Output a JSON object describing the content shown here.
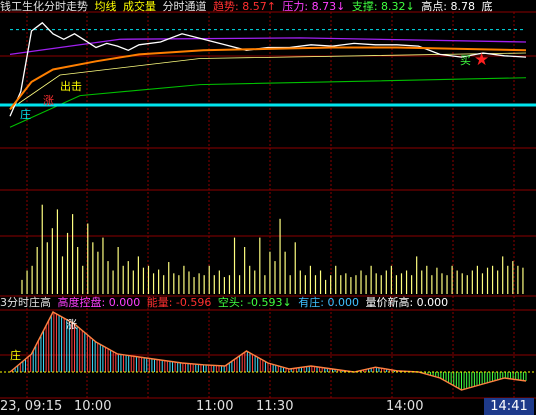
{
  "header_main": {
    "title": "钱工生化分时走势",
    "avg_label": "均线",
    "vol_label": "成交量",
    "channel_label": "分时通道",
    "trend": "趋势: 8.57↑",
    "pressure": "压力: 8.73↓",
    "support": "支撑: 8.32↓",
    "high": "高点: 8.78",
    "tail": "底"
  },
  "header_sub": {
    "title": "3分时庄高",
    "control": "高度控盘: 0.000",
    "energy": "能量: -0.596",
    "short": "空头: -0.593↓",
    "banker": "有庄: 0.000",
    "new_high": "量价新高: 0.000"
  },
  "time_axis": {
    "first": "23, 09:15",
    "t1000": "10:00",
    "t1100": "11:00",
    "t1130": "11:30",
    "t1400": "14:00",
    "cursor": "14:41"
  },
  "chart_tags": {
    "zhuang": "庄",
    "chuji": "出击",
    "zhang": "涨",
    "mai": "买",
    "sub_zhuang": "庄",
    "sub_zhang": "涨"
  },
  "colors": {
    "background": "#000000",
    "grid": "#8b0000",
    "price_line": "#ffffff",
    "avg_line": "#ff7f00",
    "channel_upper": "#a020f0",
    "channel_lower": "#00c000",
    "baseline": "#00e5ee",
    "volume": "#ffff80",
    "trend_text": "#ff3030",
    "pressure_text": "#ff40ff",
    "support_text": "#40ff40",
    "high_text": "#ffffff"
  },
  "chart_data": [
    {
      "type": "line",
      "title": "钱工生化分时走势",
      "x_ticks": [
        "09:15",
        "10:00",
        "11:00",
        "11:30",
        "14:00"
      ],
      "ylim": [
        8.0,
        8.8
      ],
      "series": [
        {
          "name": "分时走势",
          "x": [
            0,
            5,
            10,
            15,
            20,
            25,
            30,
            35,
            40,
            45,
            50,
            55,
            60,
            70,
            80,
            90,
            100,
            110,
            120,
            130,
            140,
            150,
            160,
            170,
            180,
            190,
            200,
            210,
            220,
            230,
            240
          ],
          "values": [
            8.1,
            8.28,
            8.72,
            8.78,
            8.7,
            8.66,
            8.7,
            8.65,
            8.6,
            8.63,
            8.61,
            8.58,
            8.62,
            8.64,
            8.7,
            8.66,
            8.62,
            8.58,
            8.6,
            8.6,
            8.62,
            8.61,
            8.63,
            8.62,
            8.62,
            8.61,
            8.55,
            8.53,
            8.56,
            8.54,
            8.53
          ]
        },
        {
          "name": "均线",
          "x": [
            0,
            10,
            20,
            40,
            60,
            90,
            120,
            150,
            180,
            210,
            240
          ],
          "values": [
            8.15,
            8.35,
            8.44,
            8.5,
            8.55,
            8.58,
            8.59,
            8.6,
            8.6,
            8.59,
            8.58
          ]
        }
      ]
    },
    {
      "type": "bar",
      "title": "成交量",
      "values": [
        0.15,
        0.25,
        0.3,
        0.5,
        0.95,
        0.55,
        0.7,
        0.9,
        0.4,
        0.65,
        0.85,
        0.5,
        0.3,
        0.75,
        0.55,
        0.45,
        0.6,
        0.35,
        0.25,
        0.5,
        0.3,
        0.35,
        0.25,
        0.4,
        0.28,
        0.3,
        0.22,
        0.26,
        0.2,
        0.34,
        0.22,
        0.2,
        0.3,
        0.24,
        0.18,
        0.22,
        0.2,
        0.3,
        0.2,
        0.25,
        0.18,
        0.2,
        0.6,
        0.2,
        0.5,
        0.3,
        0.25,
        0.6,
        0.2,
        0.45,
        0.35,
        0.8,
        0.45,
        0.2,
        0.55,
        0.25,
        0.2,
        0.3,
        0.2,
        0.25,
        0.15,
        0.2,
        0.3,
        0.2,
        0.22,
        0.18,
        0.2,
        0.25,
        0.2,
        0.3,
        0.22,
        0.2,
        0.25,
        0.3,
        0.2,
        0.22,
        0.25,
        0.2,
        0.4,
        0.25,
        0.3,
        0.2,
        0.28,
        0.22,
        0.2,
        0.3,
        0.25,
        0.22,
        0.2,
        0.25,
        0.3,
        0.22,
        0.28,
        0.3,
        0.25,
        0.4,
        0.3,
        0.35,
        0.3,
        0.28
      ]
    },
    {
      "type": "line",
      "title": "3分时庄高",
      "x": [
        0,
        10,
        20,
        30,
        40,
        50,
        60,
        70,
        80,
        90,
        100,
        110,
        120,
        130,
        140,
        150,
        160,
        170,
        180,
        190,
        200,
        210,
        220,
        230,
        240
      ],
      "values": [
        0,
        0.3,
        1.0,
        0.8,
        0.5,
        0.3,
        0.25,
        0.2,
        0.15,
        0.12,
        0.1,
        0.35,
        0.15,
        0.05,
        0.1,
        0.05,
        0.0,
        0.08,
        0.02,
        0.0,
        -0.1,
        -0.3,
        -0.2,
        -0.1,
        -0.15
      ]
    }
  ]
}
